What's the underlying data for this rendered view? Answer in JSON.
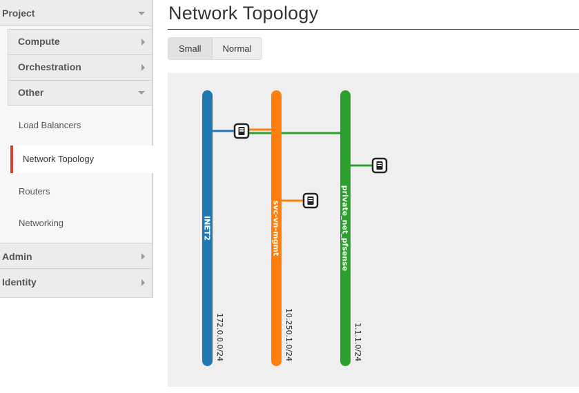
{
  "sidebar": {
    "project_label": "Project",
    "compute_label": "Compute",
    "orchestration_label": "Orchestration",
    "other_label": "Other",
    "items": [
      {
        "label": "Load Balancers"
      },
      {
        "label": "Network Topology"
      },
      {
        "label": "Routers"
      },
      {
        "label": "Networking"
      }
    ],
    "admin_label": "Admin",
    "identity_label": "Identity"
  },
  "main": {
    "title": "Network Topology",
    "size_buttons": {
      "small": "Small",
      "normal": "Normal"
    }
  },
  "topology": {
    "networks": [
      {
        "name": "INET2",
        "cidr": "172.0.0.0/24",
        "color": "#1f77b4"
      },
      {
        "name": "svc-vn-mgmt",
        "cidr": "10.250.1.0/24",
        "color": "#ff7f0e"
      },
      {
        "name": "private_net_pfsense",
        "cidr": "1.1.1.0/24",
        "color": "#2ca02c"
      }
    ],
    "instances": [
      {
        "icon": "server-icon",
        "connected_networks": [
          "INET2",
          "svc-vn-mgmt",
          "private_net_pfsense"
        ]
      },
      {
        "icon": "server-icon",
        "connected_networks": [
          "private_net_pfsense"
        ]
      },
      {
        "icon": "server-icon",
        "connected_networks": [
          "svc-vn-mgmt"
        ]
      }
    ]
  },
  "colors": {
    "active_indicator": "#d8432b",
    "topology_background": "#efefef"
  }
}
